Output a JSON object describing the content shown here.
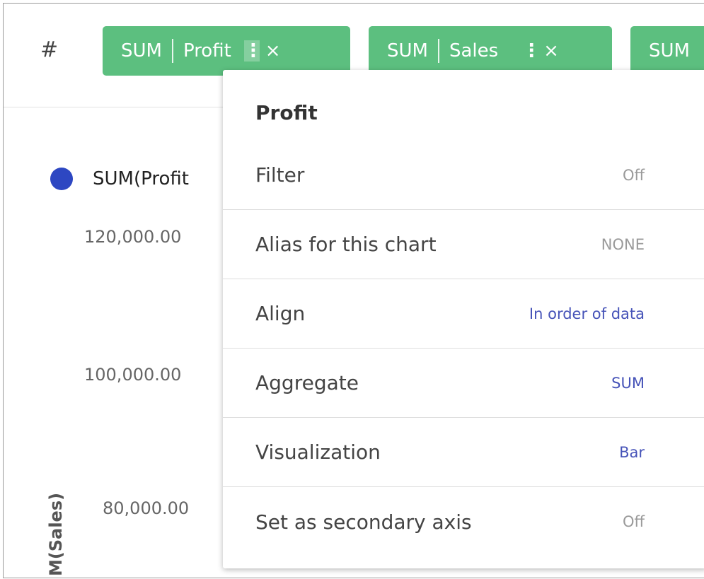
{
  "toolbar": {
    "row_icon": "#",
    "pills": [
      {
        "func": "SUM",
        "field": "Profit",
        "kebab": "⋮",
        "close": "×"
      },
      {
        "func": "SUM",
        "field": "Sales",
        "kebab": "⋮",
        "close": "×"
      },
      {
        "func": "SUM"
      }
    ]
  },
  "chart": {
    "legend": {
      "label": "SUM(Profit",
      "color": "#2d47c2"
    },
    "y_ticks": [
      "120,000.00",
      "100,000.00",
      "80,000.00"
    ],
    "y_axis_label": "M(Sales)"
  },
  "menu": {
    "title": "Profit",
    "items": [
      {
        "label": "Filter",
        "value": "Off"
      },
      {
        "label": "Alias for this chart",
        "value": "NONE"
      },
      {
        "label": "Align",
        "value": "In order of data"
      },
      {
        "label": "Aggregate",
        "value": "SUM"
      },
      {
        "label": "Visualization",
        "value": "Bar"
      },
      {
        "label": "Set as secondary axis",
        "value": "Off"
      }
    ]
  },
  "colors": {
    "pill": "#5cbf7f",
    "accent_value": "#4653b8",
    "muted_value": "#9a9a9a"
  }
}
